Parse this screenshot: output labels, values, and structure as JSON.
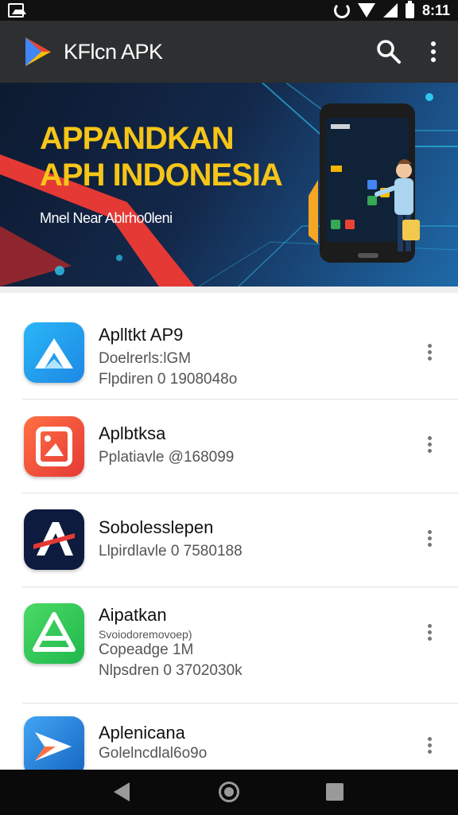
{
  "status_bar": {
    "time": "8:11",
    "icons": [
      "gallery-icon",
      "rotate-icon",
      "wifi-icon",
      "signal-icon",
      "battery-icon"
    ]
  },
  "app_bar": {
    "title": "KFlcn APK",
    "icons": [
      "app-logo-icon",
      "search-icon",
      "more-vert-icon"
    ]
  },
  "banner": {
    "title_line1": "APPANDKAN",
    "title_line2": "APH INDONESIA",
    "subtitle": "Mnel Near Ablrho0leni"
  },
  "apps": [
    {
      "title": "Aplltkt AP9",
      "lines": [
        "Doelrerls:lGM",
        "Flpdiren  0 1908048o"
      ],
      "icon": "arrow-up-app-icon",
      "colors": [
        "#1e88e5",
        "#29b6f6"
      ]
    },
    {
      "title": "Aplbtksa",
      "lines": [
        "Pplatiavle  @168099"
      ],
      "icon": "photo-frame-app-icon",
      "colors": [
        "#e53935",
        "#ff7043"
      ]
    },
    {
      "title": "Sobolesslepen",
      "lines": [
        "Llpirdlavle  0 7580188"
      ],
      "icon": "letter-a-app-icon",
      "colors": [
        "#0d1b3e",
        "#1a2a5c"
      ]
    },
    {
      "title": "Aipatkan",
      "lines_small": [
        "Svoiodoremovoep)"
      ],
      "lines": [
        "Copeadge 1M",
        "Nlpsdren  0 3702030k"
      ],
      "icon": "triangle-app-icon",
      "colors": [
        "#1fb84d",
        "#4cd964"
      ]
    },
    {
      "title": "Aplenicana",
      "lines": [
        "Golelncdlal6o9o"
      ],
      "icon": "forward-arrow-app-icon",
      "colors": [
        "#1565c0",
        "#42a5f5"
      ]
    }
  ],
  "nav_bar": {
    "icons": [
      "back-icon",
      "home-icon",
      "recent-apps-icon"
    ]
  }
}
